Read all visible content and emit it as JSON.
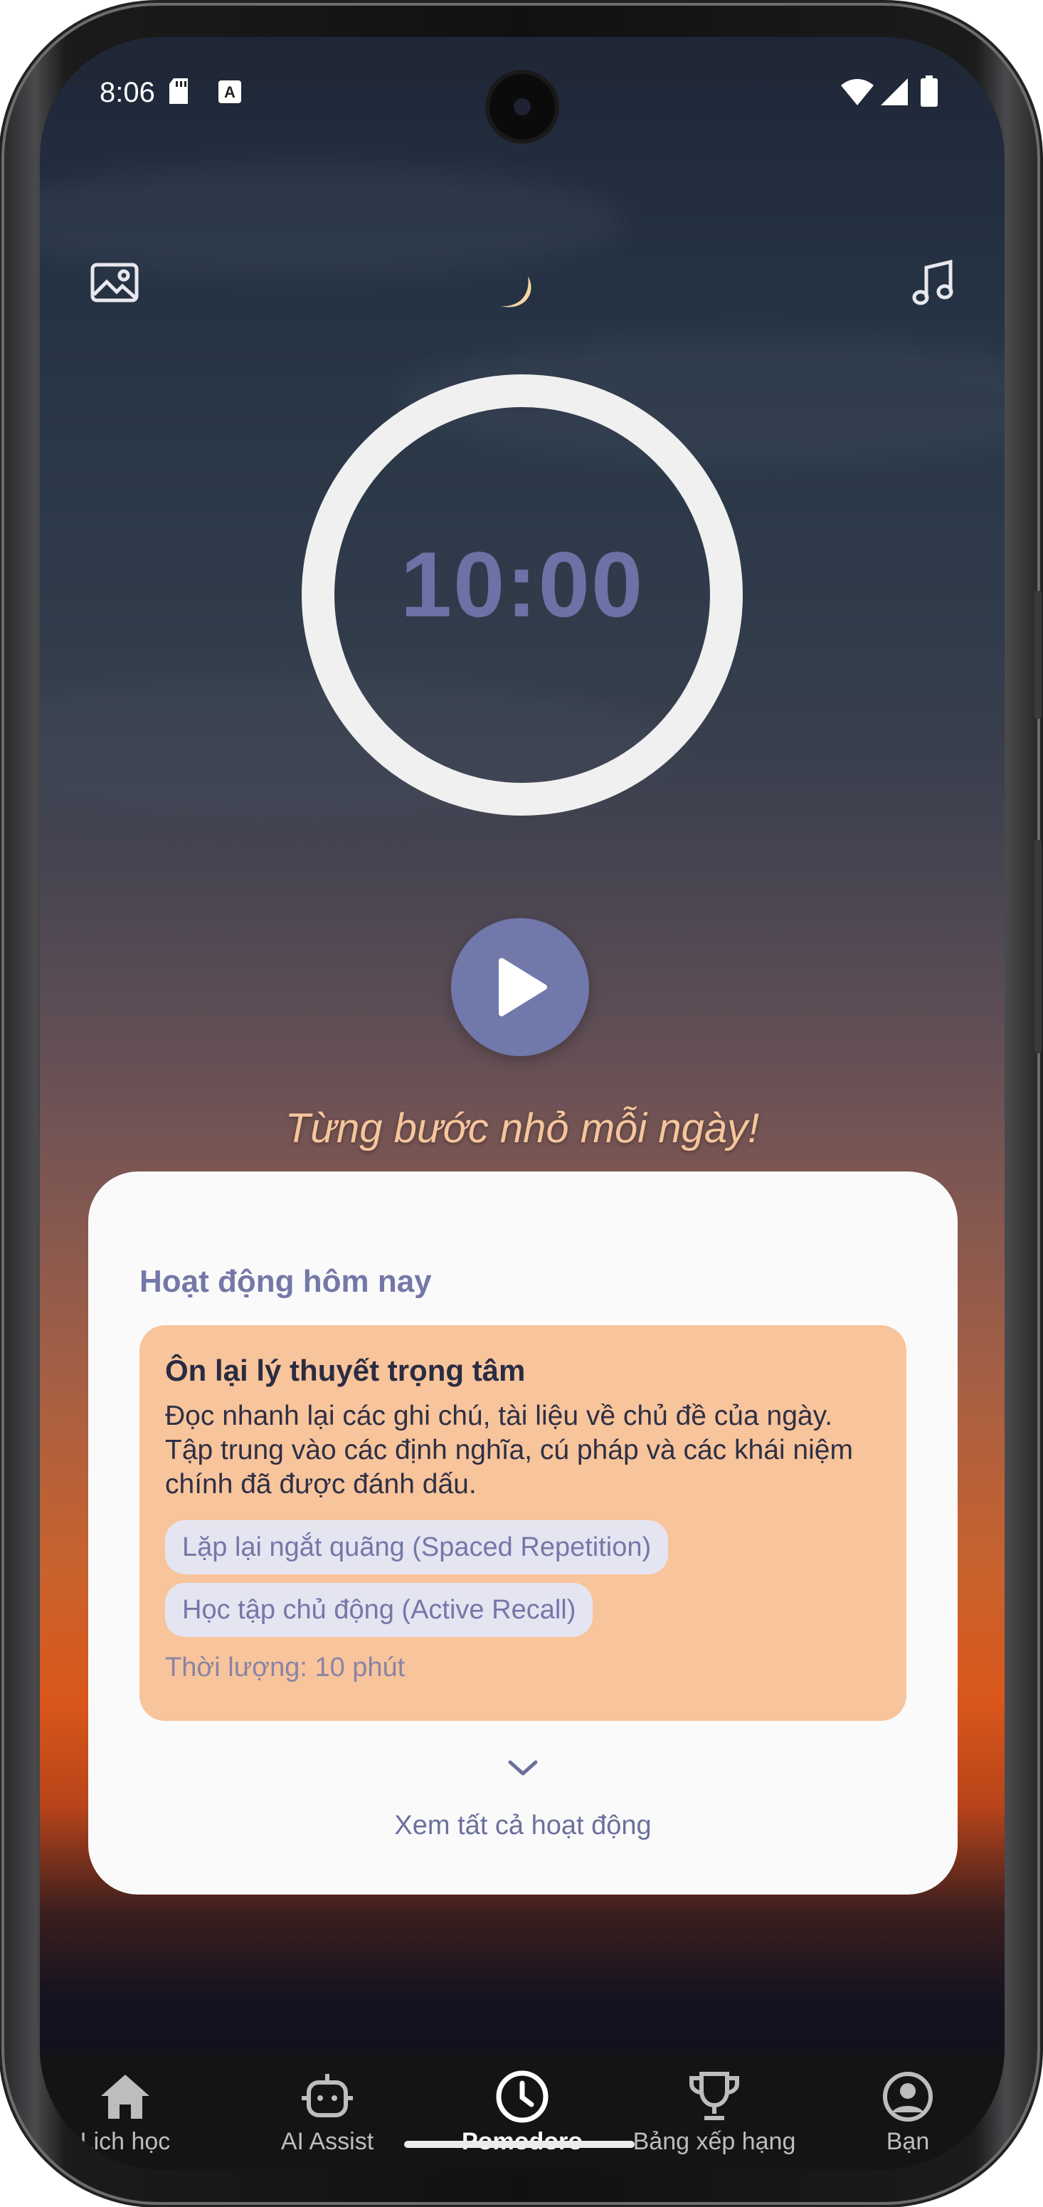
{
  "status_bar": {
    "time": "8:06"
  },
  "header": {
    "background_icon": "image-icon",
    "music_icon": "music-note-icon"
  },
  "timer": {
    "display": "10:00"
  },
  "controls": {
    "play_icon": "play-icon"
  },
  "motto": "Từng bước nhỏ mỗi ngày!",
  "activities": {
    "heading": "Hoạt động hôm nay",
    "items": [
      {
        "title": "Ôn lại lý thuyết trọng tâm",
        "description": "Đọc nhanh lại các ghi chú, tài liệu về chủ đề của ngày. Tập trung vào các định nghĩa, cú pháp và các khái niệm chính đã được đánh dấu.",
        "tags": [
          "Lặp lại ngắt quãng (Spaced Repetition)",
          "Học tập chủ động (Active Recall)"
        ],
        "duration": "Thời lượng: 10 phút"
      }
    ],
    "see_all": "Xem tất cả hoạt động"
  },
  "bottom_nav": {
    "items": [
      {
        "label": "Lịch học",
        "icon": "home-icon",
        "active": false
      },
      {
        "label": "AI Assist",
        "icon": "robot-icon",
        "active": false
      },
      {
        "label": "Pomodoro",
        "icon": "clock-icon",
        "active": true
      },
      {
        "label": "Bảng xếp hạng",
        "icon": "trophy-icon",
        "active": false
      },
      {
        "label": "Bạn",
        "icon": "profile-icon",
        "active": false
      }
    ]
  },
  "colors": {
    "accent": "#7178aa",
    "card_background": "#fafafa",
    "activity_background": "#f8c49b",
    "tag_background": "#e5e4f1",
    "motto": "#f6c59c"
  }
}
